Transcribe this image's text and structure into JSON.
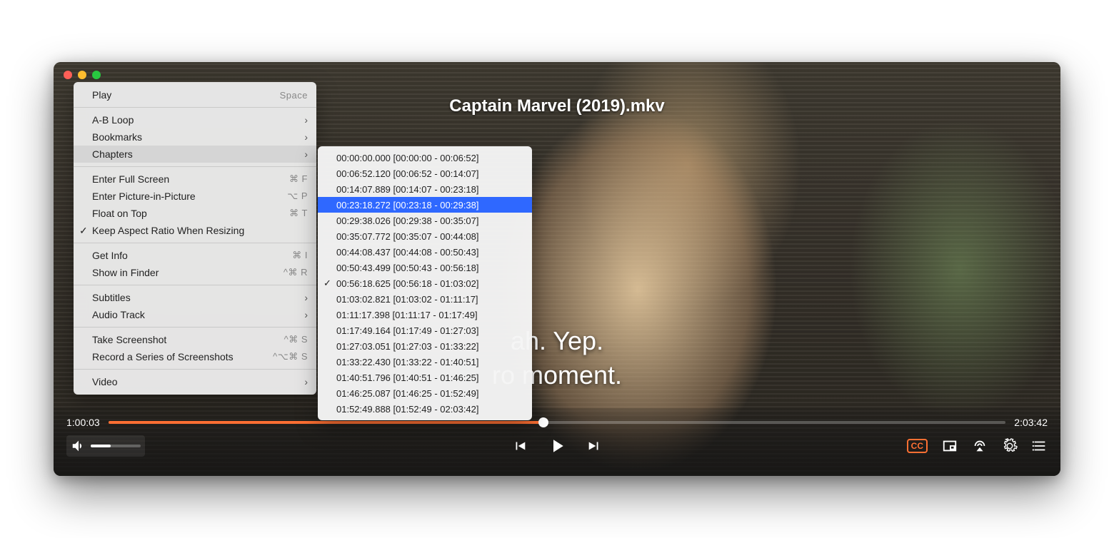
{
  "window_title": "Captain Marvel (2019).mkv",
  "subtitles": {
    "line1": "ah. Yep.",
    "line2": "ro moment."
  },
  "playback": {
    "current_time": "1:00:03",
    "total_time": "2:03:42",
    "progress_percent": 48.5
  },
  "menu": [
    {
      "label": "Play",
      "shortcut": "Space"
    },
    {
      "sep": true
    },
    {
      "label": "A-B Loop",
      "submenu": true
    },
    {
      "label": "Bookmarks",
      "submenu": true
    },
    {
      "label": "Chapters",
      "submenu": true,
      "highlight": true
    },
    {
      "sep": true
    },
    {
      "label": "Enter Full Screen",
      "shortcut": "⌘ F"
    },
    {
      "label": "Enter Picture-in-Picture",
      "shortcut": "⌥ P"
    },
    {
      "label": "Float on Top",
      "shortcut": "⌘ T"
    },
    {
      "label": "Keep Aspect Ratio When Resizing",
      "checked": true
    },
    {
      "sep": true
    },
    {
      "label": "Get Info",
      "shortcut": "⌘ I"
    },
    {
      "label": "Show in Finder",
      "shortcut": "^⌘ R"
    },
    {
      "sep": true
    },
    {
      "label": "Subtitles",
      "submenu": true
    },
    {
      "label": "Audio Track",
      "submenu": true
    },
    {
      "sep": true
    },
    {
      "label": "Take Screenshot",
      "shortcut": "^⌘ S"
    },
    {
      "label": "Record a Series of Screenshots",
      "shortcut": "^⌥⌘ S"
    },
    {
      "sep": true
    },
    {
      "label": "Video",
      "submenu": true
    }
  ],
  "chapters": [
    {
      "label": "00:00:00.000 [00:00:00 - 00:06:52]"
    },
    {
      "label": "00:06:52.120 [00:06:52 - 00:14:07]"
    },
    {
      "label": "00:14:07.889 [00:14:07 - 00:23:18]"
    },
    {
      "label": "00:23:18.272 [00:23:18 - 00:29:38]",
      "selected": true
    },
    {
      "label": "00:29:38.026 [00:29:38 - 00:35:07]"
    },
    {
      "label": "00:35:07.772 [00:35:07 - 00:44:08]"
    },
    {
      "label": "00:44:08.437 [00:44:08 - 00:50:43]"
    },
    {
      "label": "00:50:43.499 [00:50:43 - 00:56:18]"
    },
    {
      "label": "00:56:18.625 [00:56:18 - 01:03:02]",
      "checked": true
    },
    {
      "label": "01:03:02.821 [01:03:02 - 01:11:17]"
    },
    {
      "label": "01:11:17.398 [01:11:17 - 01:17:49]"
    },
    {
      "label": "01:17:49.164 [01:17:49 - 01:27:03]"
    },
    {
      "label": "01:27:03.051 [01:27:03 - 01:33:22]"
    },
    {
      "label": "01:33:22.430 [01:33:22 - 01:40:51]"
    },
    {
      "label": "01:40:51.796 [01:40:51 - 01:46:25]"
    },
    {
      "label": "01:46:25.087 [01:46:25 - 01:52:49]"
    },
    {
      "label": "01:52:49.888 [01:52:49 - 02:03:42]"
    }
  ],
  "cc_label": "CC"
}
